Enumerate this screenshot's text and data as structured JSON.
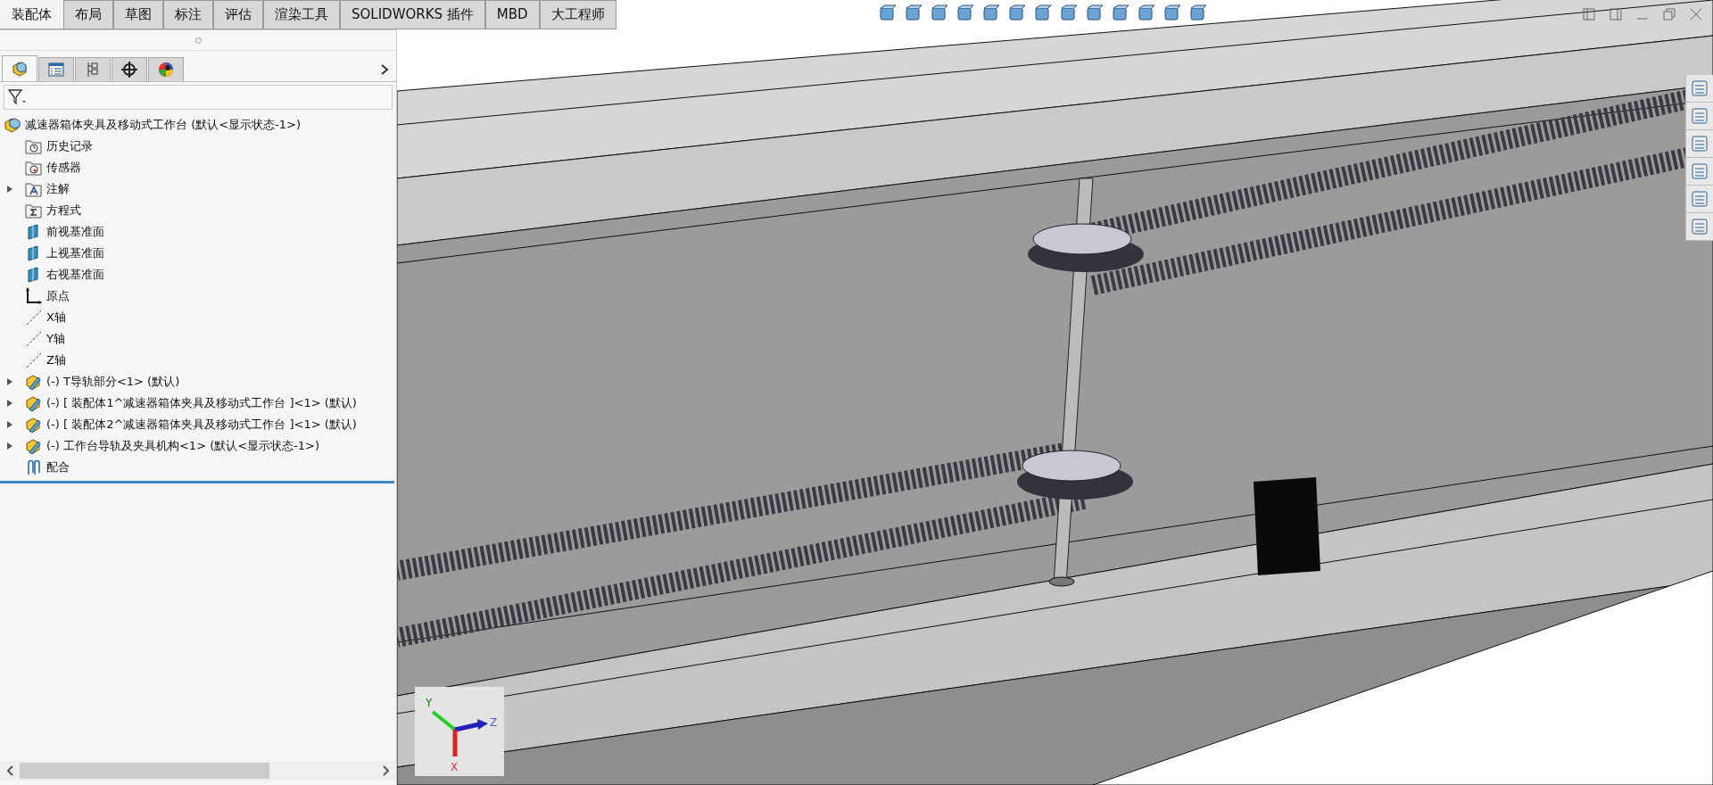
{
  "command_tabs": [
    {
      "label": "装配体",
      "selected": true
    },
    {
      "label": "布局",
      "selected": false
    },
    {
      "label": "草图",
      "selected": false
    },
    {
      "label": "标注",
      "selected": false
    },
    {
      "label": "评估",
      "selected": false
    },
    {
      "label": "渲染工具",
      "selected": false
    },
    {
      "label": "SOLIDWORKS 插件",
      "selected": false
    },
    {
      "label": "MBD",
      "selected": false
    },
    {
      "label": "大工程师",
      "selected": false
    }
  ],
  "panel_tabs": [
    {
      "kind": "features",
      "selected": true
    },
    {
      "kind": "properties",
      "selected": false
    },
    {
      "kind": "configurations",
      "selected": false
    },
    {
      "kind": "dimxpert",
      "selected": false
    },
    {
      "kind": "display",
      "selected": false
    }
  ],
  "feature_tree": {
    "root": {
      "label": "减速器箱体夹具及移动式工作台 (默认<显示状态-1>)"
    },
    "children": [
      {
        "label": "历史记录",
        "kind": "history",
        "collapsed": false
      },
      {
        "label": "传感器",
        "kind": "sensor",
        "collapsed": false
      },
      {
        "label": "注解",
        "kind": "annotation",
        "collapsed": true
      },
      {
        "label": "方程式",
        "kind": "equation",
        "collapsed": false
      },
      {
        "label": "前视基准面",
        "kind": "plane",
        "collapsed": false
      },
      {
        "label": "上视基准面",
        "kind": "plane",
        "collapsed": false
      },
      {
        "label": "右视基准面",
        "kind": "plane",
        "collapsed": false
      },
      {
        "label": "原点",
        "kind": "origin",
        "collapsed": false
      },
      {
        "label": "X轴",
        "kind": "axis",
        "collapsed": false
      },
      {
        "label": "Y轴",
        "kind": "axis",
        "collapsed": false
      },
      {
        "label": "Z轴",
        "kind": "axis",
        "collapsed": false
      },
      {
        "label": "(-) T导轨部分<1> (默认)",
        "kind": "subassembly",
        "collapsed": true
      },
      {
        "label": "(-) [ 装配体1^减速器箱体夹具及移动式工作台 ]<1> (默认)",
        "kind": "subassembly",
        "collapsed": true
      },
      {
        "label": "(-) [ 装配体2^减速器箱体夹具及移动式工作台 ]<1> (默认)",
        "kind": "subassembly",
        "collapsed": true
      },
      {
        "label": "(-) 工作台导轨及夹具机构<1> (默认<显示状态-1>)",
        "kind": "subassembly",
        "collapsed": true
      },
      {
        "label": "配合",
        "kind": "mates",
        "collapsed": false
      }
    ]
  },
  "triad": {
    "x": "X",
    "y": "Y",
    "z": "Z"
  }
}
